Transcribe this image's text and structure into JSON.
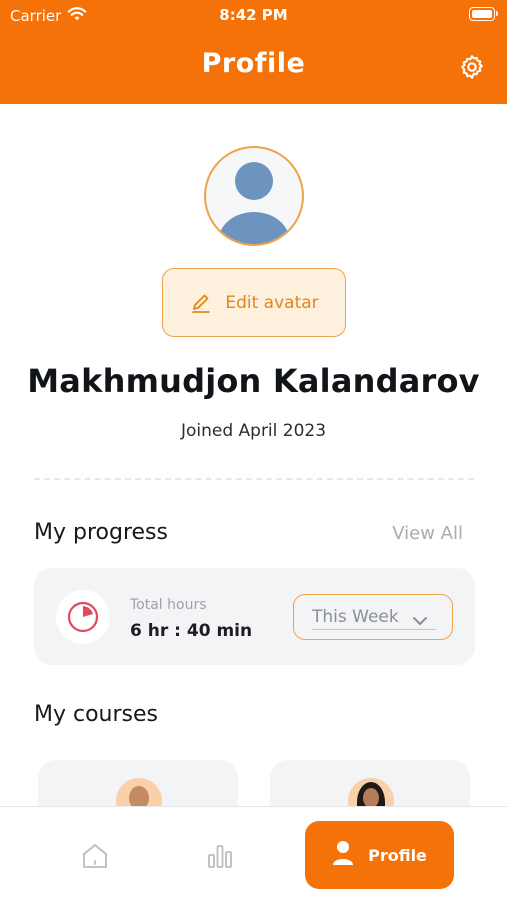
{
  "status_bar": {
    "carrier": "Carrier",
    "time": "8:42 PM",
    "wifi_icon": "wifi-icon",
    "battery_icon": "battery-icon"
  },
  "header": {
    "title": "Profile",
    "settings_icon": "gear-icon",
    "background_color": "#f57208"
  },
  "profile": {
    "avatar_icon": "user-avatar-placeholder",
    "edit_button_label": "Edit avatar",
    "edit_icon": "pencil-icon",
    "name": "Makhmudjon Kalandarov",
    "joined": "Joined April 2023"
  },
  "progress": {
    "title": "My progress",
    "view_all": "View All",
    "total_label": "Total hours",
    "total_value": "6 hr : 40 min",
    "period_select": "This Week",
    "clock_icon": "clock-icon"
  },
  "courses": {
    "title": "My courses",
    "items": [
      {
        "avatar": "instructor-avatar"
      },
      {
        "avatar": "instructor-avatar"
      }
    ]
  },
  "tab_bar": {
    "items": [
      {
        "icon": "home-icon",
        "label": ""
      },
      {
        "icon": "bar-chart-icon",
        "label": ""
      },
      {
        "icon": "person-icon",
        "label": "Profile",
        "active": true
      }
    ]
  },
  "colors": {
    "accent": "#f57208",
    "accent_light": "#fdf0dd",
    "accent_border": "#f0a24a"
  }
}
